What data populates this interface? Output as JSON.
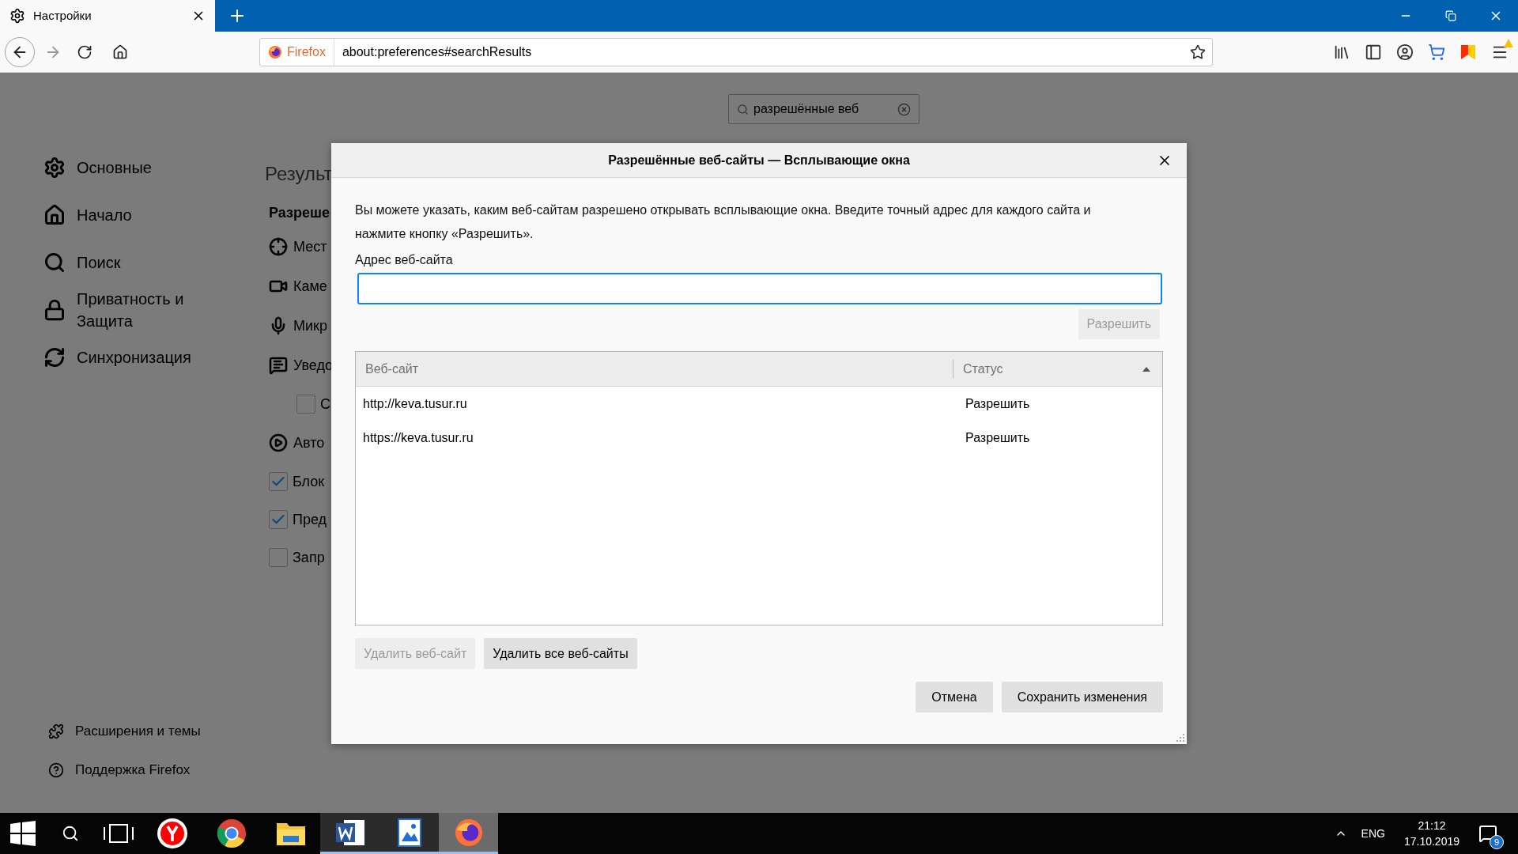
{
  "browser": {
    "tab": {
      "title": "Настройки"
    },
    "identity_label": "Firefox",
    "url": "about:preferences#searchResults"
  },
  "search": {
    "value": "разрешённые веб"
  },
  "sidebar": {
    "items": [
      {
        "label": "Основные"
      },
      {
        "label": "Начало"
      },
      {
        "label": "Поиск"
      },
      {
        "label": "Приватность и Защита"
      },
      {
        "label": "Синхронизация"
      }
    ],
    "footer": [
      {
        "label": "Расширения и темы"
      },
      {
        "label": "Поддержка Firefox"
      }
    ]
  },
  "content": {
    "heading": "Результ",
    "section": "Разреше",
    "rows": [
      {
        "kind": "permission",
        "label": "Мест"
      },
      {
        "kind": "permission",
        "label": "Каме"
      },
      {
        "kind": "permission",
        "label": "Микр"
      },
      {
        "kind": "permission",
        "label": "Уведо",
        "children": [
          {
            "kind": "checkbox",
            "label": "С",
            "checked": false
          }
        ]
      },
      {
        "kind": "permission",
        "label": "Авто"
      },
      {
        "kind": "checkbox",
        "label": "Блок",
        "checked": true
      },
      {
        "kind": "checkbox",
        "label": "Пред",
        "checked": true
      },
      {
        "kind": "checkbox",
        "label": "Запр",
        "checked": false
      }
    ]
  },
  "dialog": {
    "title": "Разрешённые веб-сайты — Всплывающие окна",
    "description": "Вы можете указать, каким веб-сайтам разрешено открывать всплывающие окна. Введите точный адрес для каждого сайта и нажмите кнопку «Разрешить».",
    "address_label": "Адрес веб-сайта",
    "allow_button": {
      "label": "Разрешить",
      "disabled": true
    },
    "table": {
      "columns": [
        "Веб-сайт",
        "Статус"
      ],
      "rows": [
        {
          "site": "http://keva.tusur.ru",
          "status": "Разрешить"
        },
        {
          "site": "https://keva.tusur.ru",
          "status": "Разрешить"
        }
      ]
    },
    "remove_buttons": [
      {
        "label": "Удалить веб-сайт",
        "disabled": true
      },
      {
        "label": "Удалить все веб-сайты",
        "disabled": false
      }
    ],
    "footer_buttons": [
      {
        "label": "Отмена"
      },
      {
        "label": "Сохранить изменения"
      }
    ]
  },
  "taskbar": {
    "apps": [
      {
        "open": false,
        "selected": false
      },
      {
        "open": false,
        "selected": false
      },
      {
        "open": false,
        "selected": false
      },
      {
        "open": true,
        "selected": false
      },
      {
        "open": true,
        "selected": false
      },
      {
        "open": true,
        "selected": true
      }
    ],
    "language": "ENG",
    "time": "21:12",
    "date": "17.10.2019",
    "notification_count": "9"
  }
}
